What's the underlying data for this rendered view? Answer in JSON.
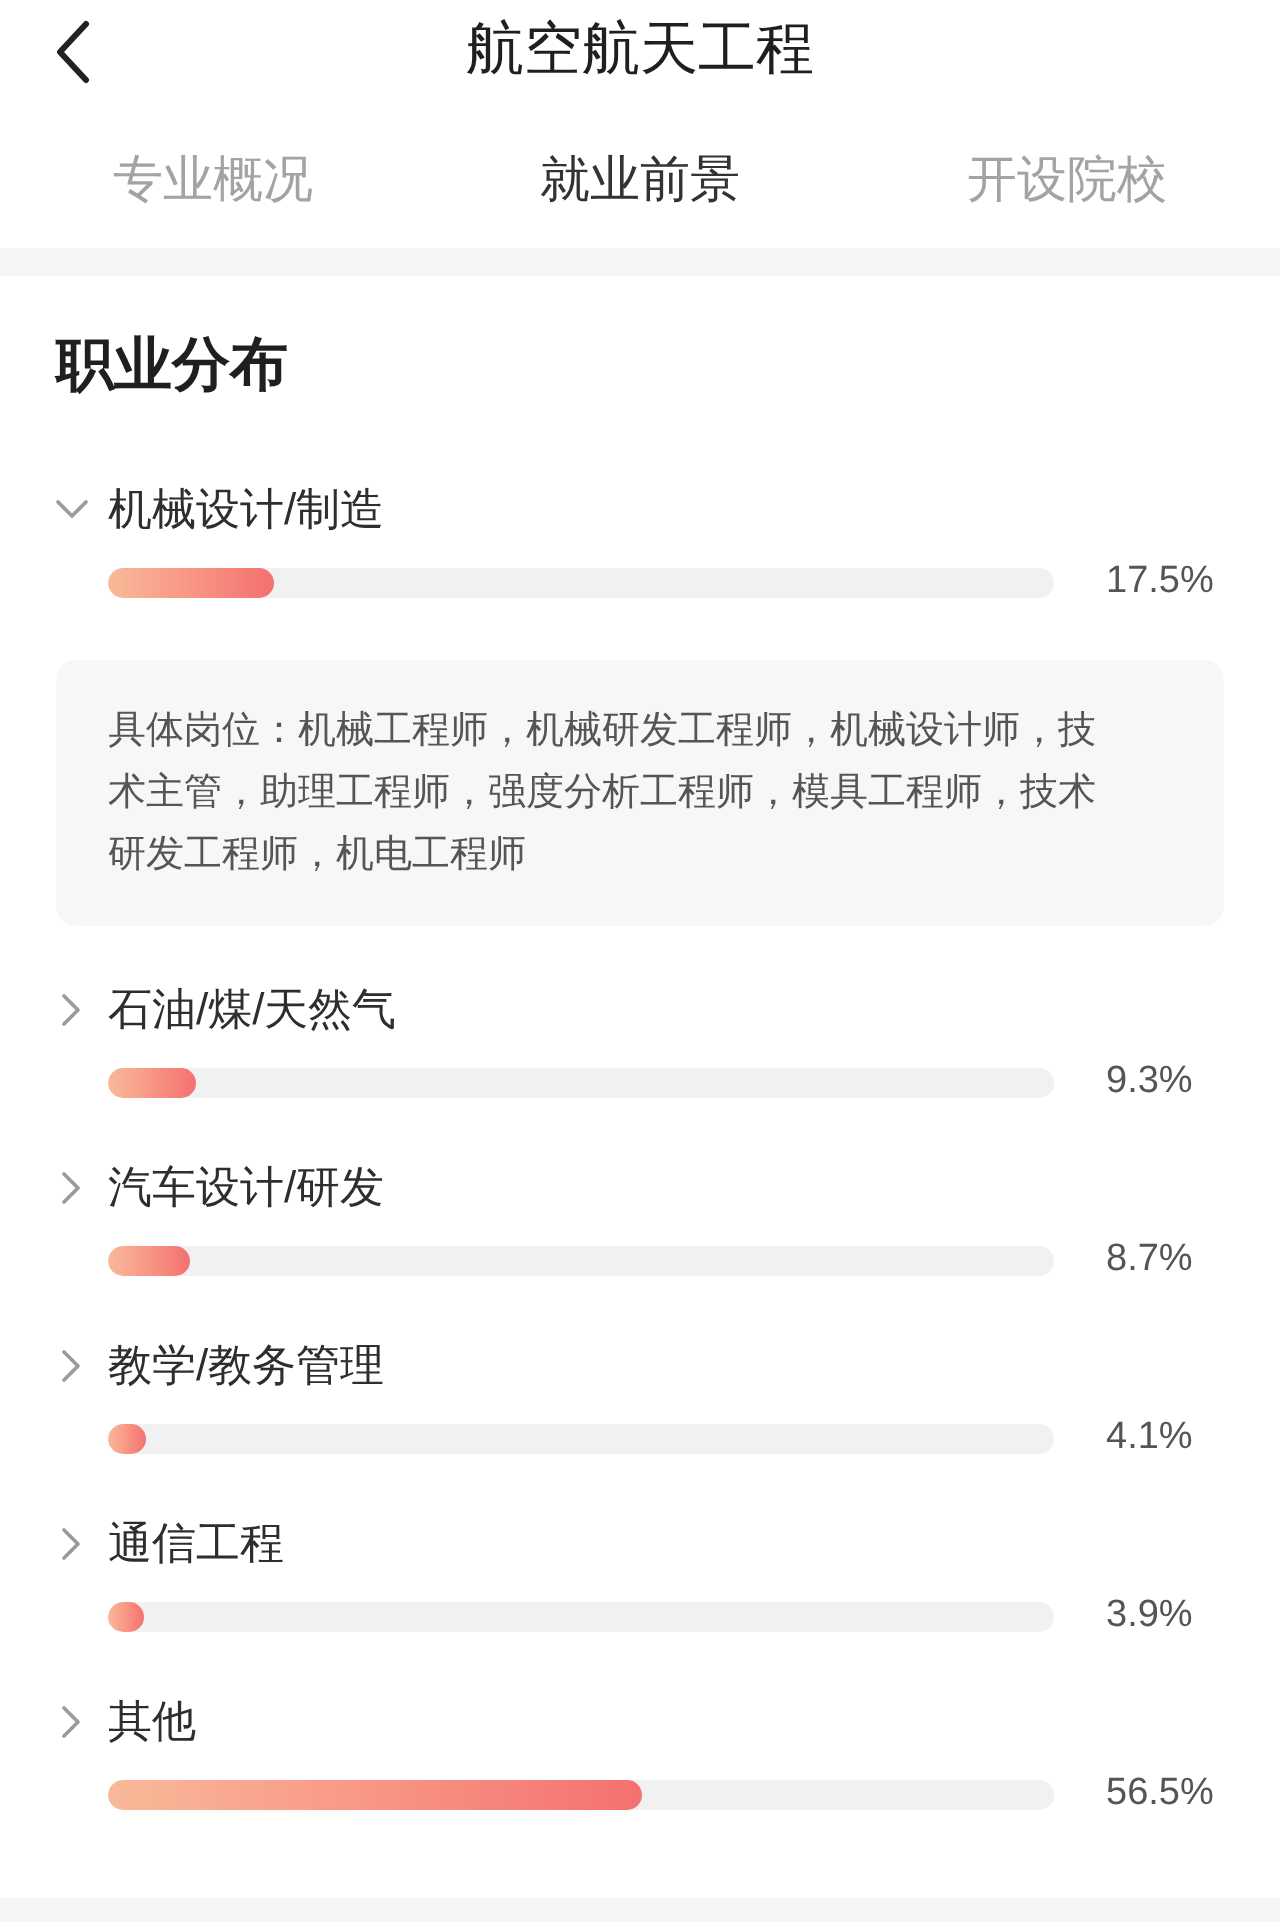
{
  "header": {
    "title": "航空航天工程"
  },
  "tabs": [
    {
      "label": "专业概况",
      "selected": false
    },
    {
      "label": "就业前景",
      "selected": true
    },
    {
      "label": "开设院校",
      "selected": false
    }
  ],
  "section": {
    "title": "职业分布",
    "careers": [
      {
        "label": "机械设计/制造",
        "expanded": true,
        "level": 0.175,
        "percent": "17.5%",
        "details": "具体岗位：机械工程师，机械研发工程师，机械设计师，技术主管，助理工程师，强度分析工程师，模具工程师，技术研发工程师，机电工程师"
      },
      {
        "label": "石油/煤/天然气",
        "expanded": false,
        "level": 0.093,
        "percent": "9.3%"
      },
      {
        "label": "汽车设计/研发",
        "expanded": false,
        "level": 0.087,
        "percent": "8.7%"
      },
      {
        "label": "教学/教务管理",
        "expanded": false,
        "level": 0.041,
        "percent": "4.1%"
      },
      {
        "label": "通信工程",
        "expanded": false,
        "level": 0.039,
        "percent": "3.9%"
      },
      {
        "label": "其他",
        "expanded": false,
        "level": 0.565,
        "percent": "56.5%"
      }
    ]
  }
}
